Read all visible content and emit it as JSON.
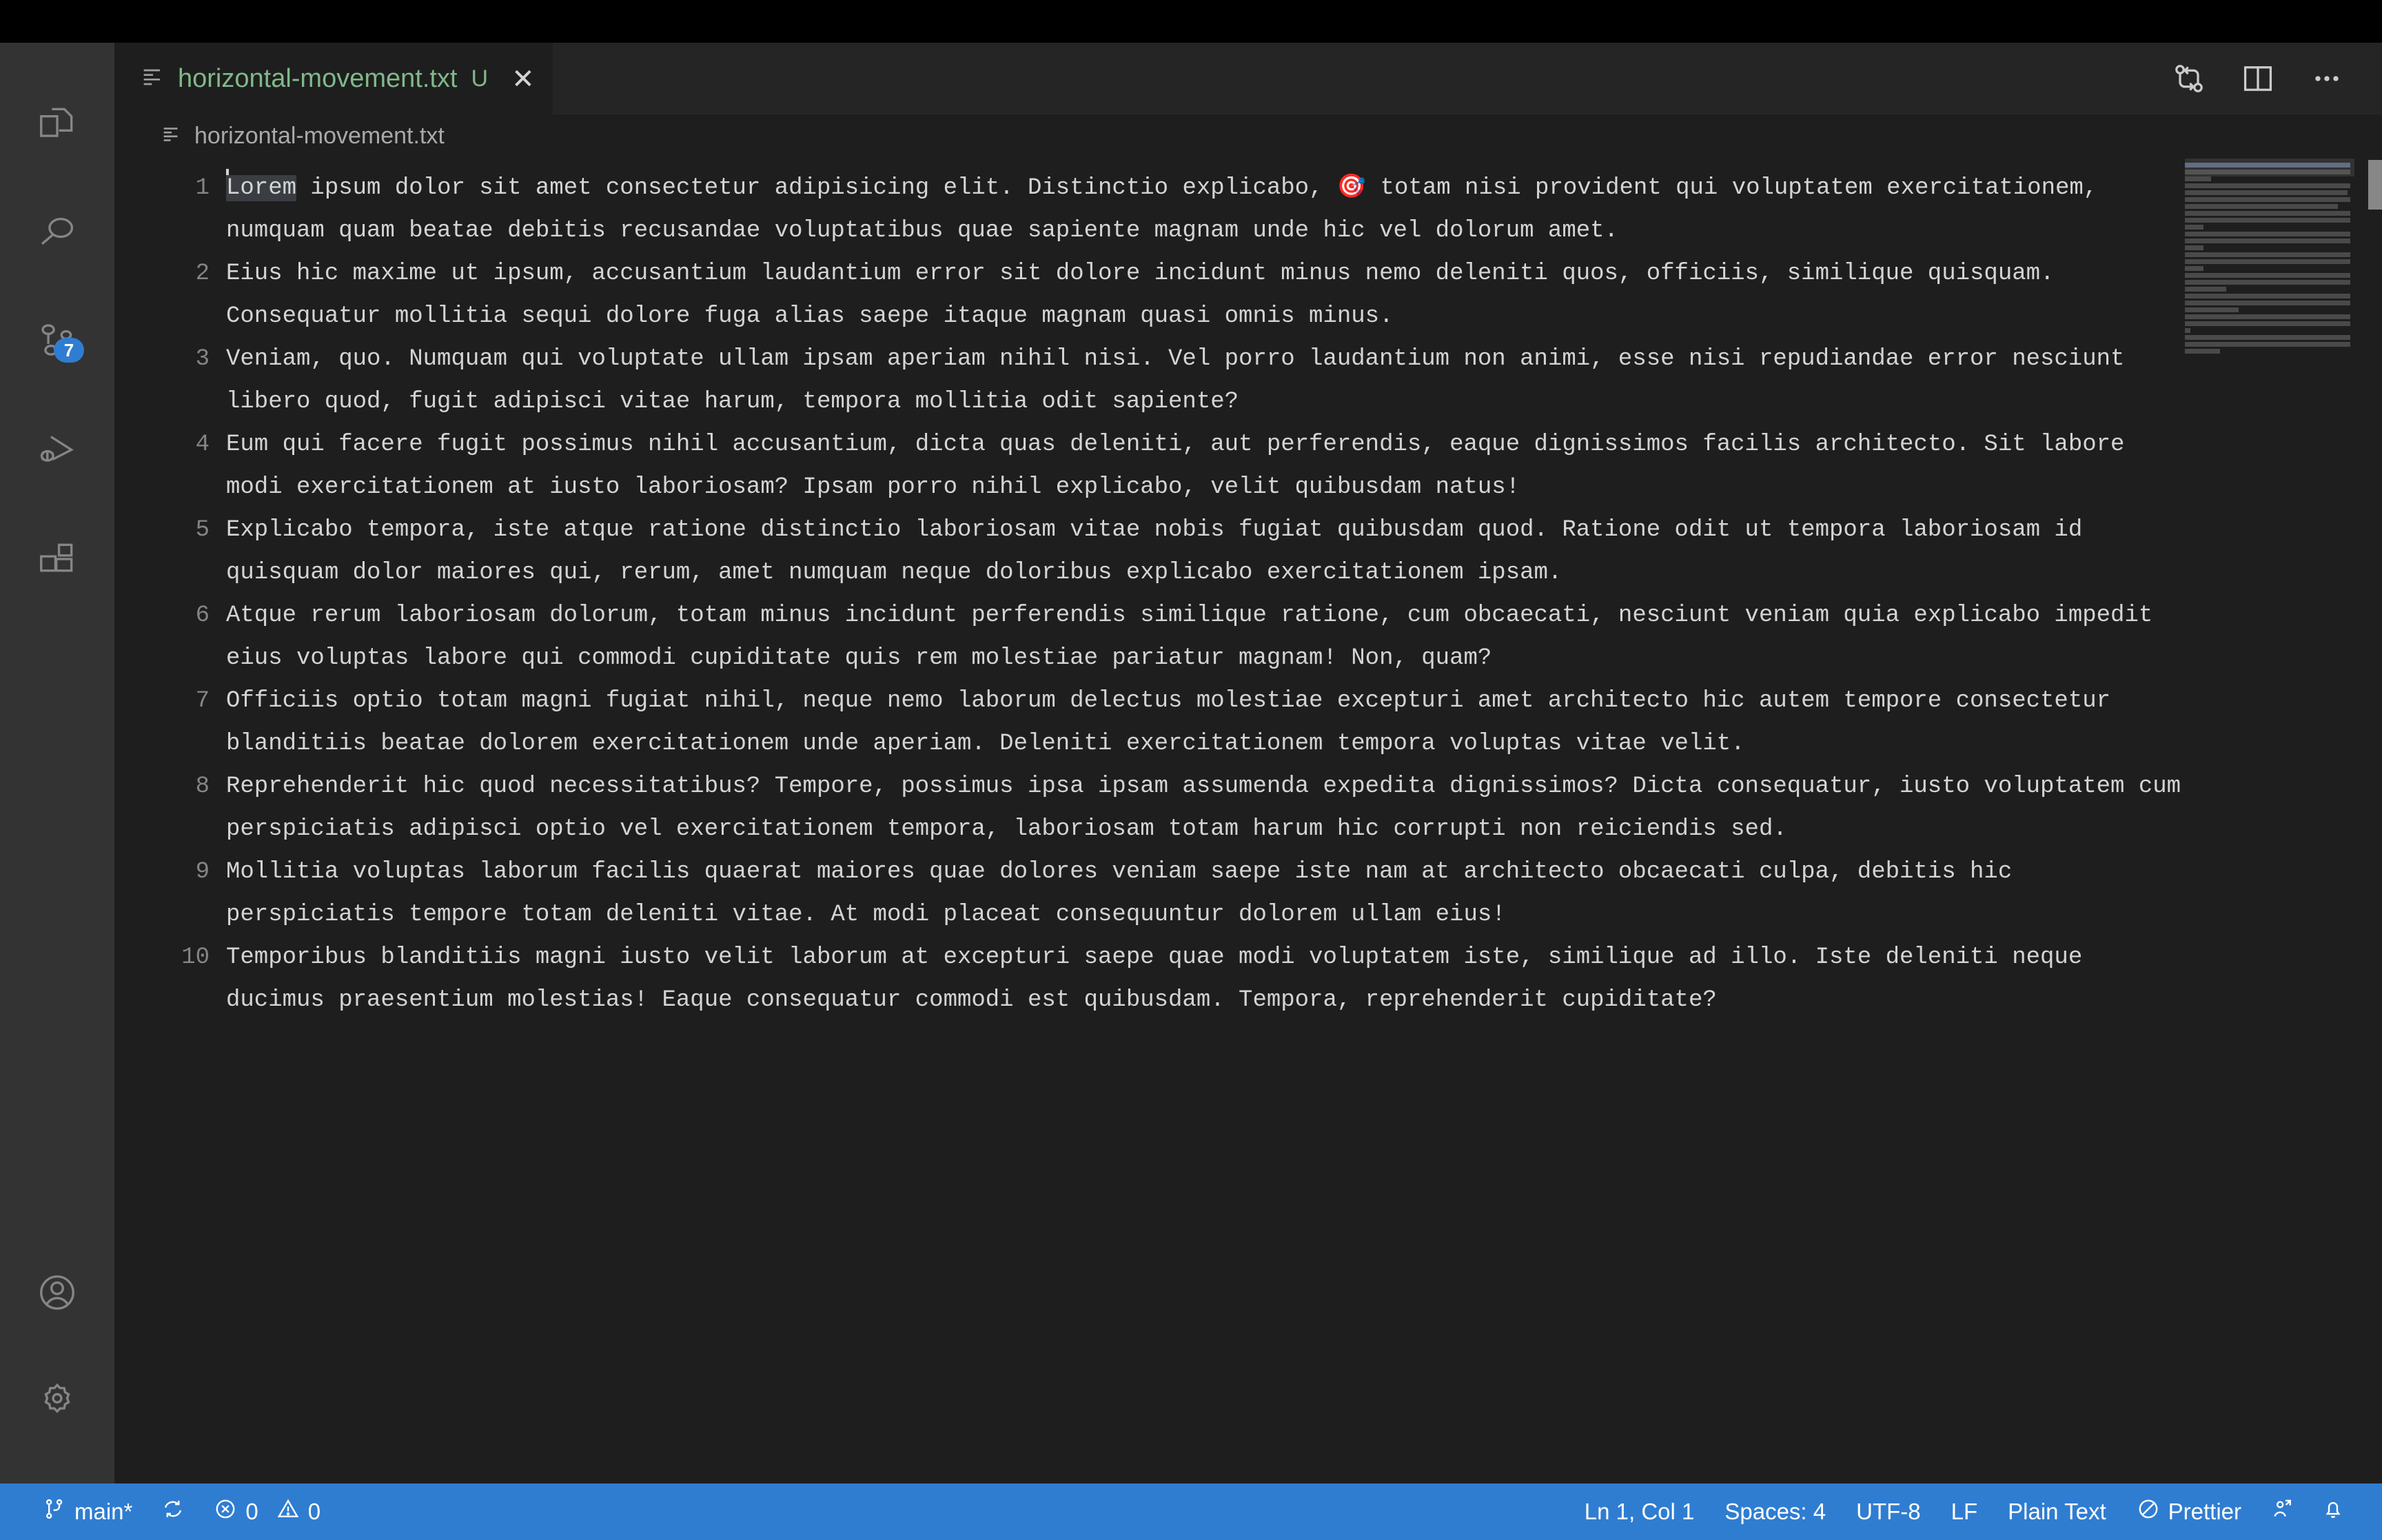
{
  "window": {
    "titlebar_color": "#000000",
    "activitybar_color": "#333333",
    "editor_bg": "#1e1e1e",
    "statusbar_color": "#2f7dd1",
    "accent_green": "#81b88b"
  },
  "activity_bar": {
    "items": [
      {
        "name": "explorer",
        "icon": "files-icon",
        "title": "Explorer"
      },
      {
        "name": "search",
        "icon": "search-icon",
        "title": "Search"
      },
      {
        "name": "source-control",
        "icon": "source-control-icon",
        "title": "Source Control",
        "badge": "7"
      },
      {
        "name": "run-debug",
        "icon": "run-and-debug-icon",
        "title": "Run and Debug"
      },
      {
        "name": "extensions",
        "icon": "extensions-icon",
        "title": "Extensions"
      }
    ],
    "bottom_items": [
      {
        "name": "accounts",
        "icon": "account-icon",
        "title": "Accounts"
      },
      {
        "name": "manage",
        "icon": "gear-icon",
        "title": "Manage"
      }
    ]
  },
  "tab": {
    "icon": "text-file-icon",
    "label": "horizontal-movement.txt",
    "git_status": "U",
    "close": "✕"
  },
  "editor_actions": [
    {
      "name": "compare-changes",
      "icon": "compare-changes-icon"
    },
    {
      "name": "split-editor-right",
      "icon": "split-editor-icon"
    },
    {
      "name": "more-actions",
      "icon": "ellipsis-icon"
    }
  ],
  "breadcrumb": {
    "icon": "text-file-icon",
    "label": "horizontal-movement.txt"
  },
  "editor": {
    "language": "Plain Text",
    "lines": [
      {
        "number": "1",
        "selected_prefix": "Lorem",
        "text": " ipsum dolor sit amet consectetur adipisicing elit. Distinctio explicabo, 🎯 totam nisi provident qui voluptatem exercitationem, numquam quam beatae debitis recusandae voluptatibus quae sapiente magnam unde hic vel dolorum amet."
      },
      {
        "number": "2",
        "text": "Eius hic maxime ut ipsum, accusantium laudantium error sit dolore incidunt minus nemo deleniti quos, officiis, similique quisquam. Consequatur mollitia sequi dolore fuga alias saepe itaque magnam quasi omnis minus."
      },
      {
        "number": "3",
        "text": "Veniam, quo. Numquam qui voluptate ullam ipsam aperiam nihil nisi. Vel porro laudantium non animi, esse nisi repudiandae error nesciunt libero quod, fugit adipisci vitae harum, tempora mollitia odit sapiente?"
      },
      {
        "number": "4",
        "text": "Eum qui facere fugit possimus nihil accusantium, dicta quas deleniti, aut perferendis, eaque dignissimos facilis architecto. Sit labore modi exercitationem at iusto laboriosam? Ipsam porro nihil explicabo, velit quibusdam natus!"
      },
      {
        "number": "5",
        "text": "Explicabo tempora, iste atque ratione distinctio laboriosam vitae nobis fugiat quibusdam quod. Ratione odit ut tempora laboriosam id quisquam dolor maiores qui, rerum, amet numquam neque doloribus explicabo exercitationem ipsam."
      },
      {
        "number": "6",
        "text": "Atque rerum laboriosam dolorum, totam minus incidunt perferendis similique ratione, cum obcaecati, nesciunt veniam quia explicabo impedit eius voluptas labore qui commodi cupiditate quis rem molestiae pariatur magnam! Non, quam?"
      },
      {
        "number": "7",
        "text": "Officiis optio totam magni fugiat nihil, neque nemo laborum delectus molestiae excepturi amet architecto hic autem tempore consectetur blanditiis beatae dolorem exercitationem unde aperiam. Deleniti exercitationem tempora voluptas vitae velit."
      },
      {
        "number": "8",
        "text": "Reprehenderit hic quod necessitatibus? Tempore, possimus ipsa ipsam assumenda expedita dignissimos? Dicta consequatur, iusto voluptatem cum perspiciatis adipisci optio vel exercitationem tempora, laboriosam totam harum hic corrupti non reiciendis sed."
      },
      {
        "number": "9",
        "text": "Mollitia voluptas laborum facilis quaerat maiores quae dolores veniam saepe iste nam at architecto obcaecati culpa, debitis hic perspiciatis tempore totam deleniti vitae. At modi placeat consequuntur dolorem ullam eius!"
      },
      {
        "number": "10",
        "text": "Temporibus blanditiis magni iusto velit laborum at excepturi saepe quae modi voluptatem iste, similique ad illo. Iste deleniti neque ducimus praesentium molestias! Eaque consequatur commodi est quibusdam. Tempora, reprehenderit cupiditate?"
      }
    ]
  },
  "statusbar": {
    "left": [
      {
        "name": "branch",
        "icon": "source-control-branch-icon",
        "label": "main*"
      },
      {
        "name": "sync",
        "icon": "sync-icon",
        "label": ""
      },
      {
        "name": "problems",
        "icon": "error-icon",
        "label": "0",
        "icon2": "warning-icon",
        "label2": "0"
      }
    ],
    "branch_label": "main*",
    "errors": "0",
    "warnings": "0",
    "right": [
      {
        "name": "cursor-position",
        "label": "Ln 1, Col 1"
      },
      {
        "name": "indentation",
        "label": "Spaces: 4"
      },
      {
        "name": "encoding",
        "label": "UTF-8"
      },
      {
        "name": "eol",
        "label": "LF"
      },
      {
        "name": "language-mode",
        "label": "Plain Text"
      },
      {
        "name": "prettier",
        "label": "Prettier",
        "icon": "prettier-circle-slash-icon"
      },
      {
        "name": "remote-broadcast",
        "label": "",
        "icon": "broadcast-icon"
      },
      {
        "name": "notifications",
        "label": "",
        "icon": "bell-icon"
      }
    ]
  }
}
